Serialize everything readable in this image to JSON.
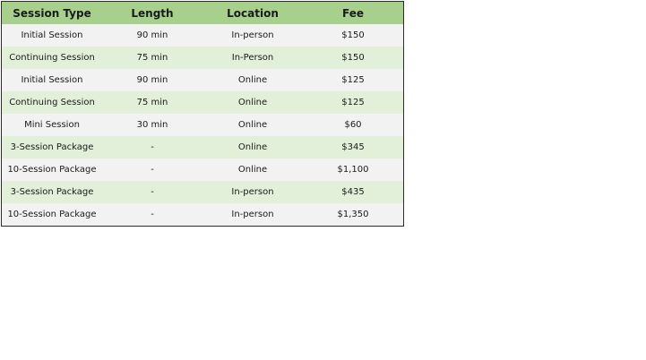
{
  "table": {
    "headers": [
      "Session Type",
      "Length",
      "Location",
      "Fee"
    ],
    "rows": [
      [
        "Initial Session",
        "90 min",
        "In-person",
        "$150"
      ],
      [
        "Continuing Session",
        "75 min",
        "In-Person",
        "$150"
      ],
      [
        "Initial Session",
        "90 min",
        "Online",
        "$125"
      ],
      [
        "Continuing Session",
        "75 min",
        "Online",
        "$125"
      ],
      [
        "Mini Session",
        "30 min",
        "Online",
        "$60"
      ],
      [
        "3-Session Package",
        "-",
        "Online",
        "$345"
      ],
      [
        "10-Session Package",
        "-",
        "Online",
        "$1,100"
      ],
      [
        "3-Session Package",
        "-",
        "In-person",
        "$435"
      ],
      [
        "10-Session Package",
        "-",
        "In-person",
        "$1,350"
      ]
    ]
  },
  "colors": {
    "header_bg": "#a8d08d",
    "row_light": "#f2f2f2",
    "row_green": "#e2efd9",
    "border": "#2b2b2b"
  }
}
